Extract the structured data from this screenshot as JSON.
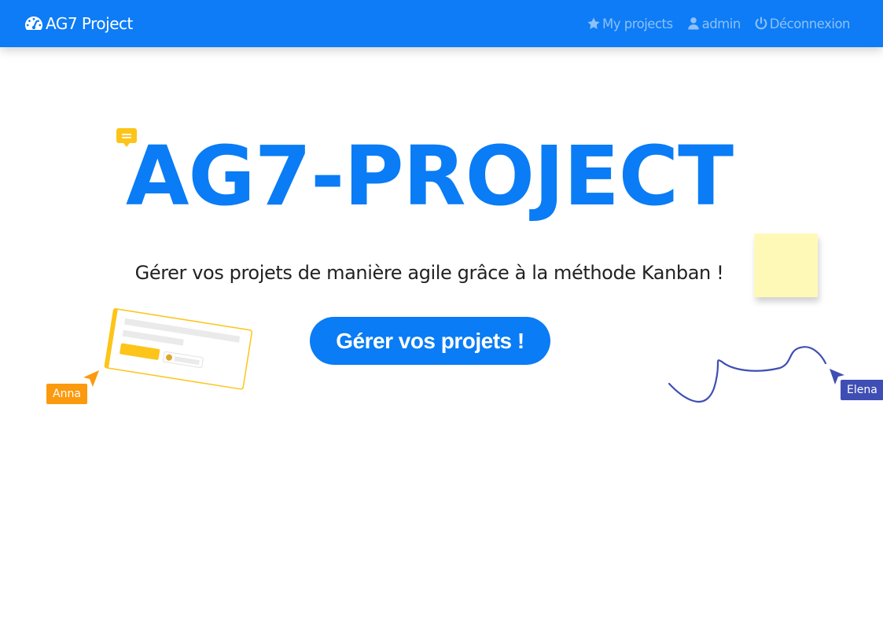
{
  "navbar": {
    "brand_icon": "tachometer-icon",
    "brand_label": "AG7 Project",
    "links": [
      {
        "icon": "star-icon",
        "label": "My projects"
      },
      {
        "icon": "user-icon",
        "label": "admin"
      },
      {
        "icon": "power-icon",
        "label": "Déconnexion"
      }
    ]
  },
  "hero": {
    "title": "AG7-PROJECT",
    "subtitle": "Gérer vos projets de manière agile grâce à la méthode Kanban !",
    "cta_label": "Gérer vos projets !"
  },
  "decorations": {
    "cursor_left_name": "Anna",
    "cursor_right_name": "Elena"
  },
  "colors": {
    "brand_blue": "#0d7cf6",
    "nav_link": "#8fc0f8",
    "cursor_anna": "#fb9a0e",
    "cursor_elena": "#3f4eb4",
    "sticky_note": "#fff9b8",
    "chat_bubble": "#fdc419"
  }
}
